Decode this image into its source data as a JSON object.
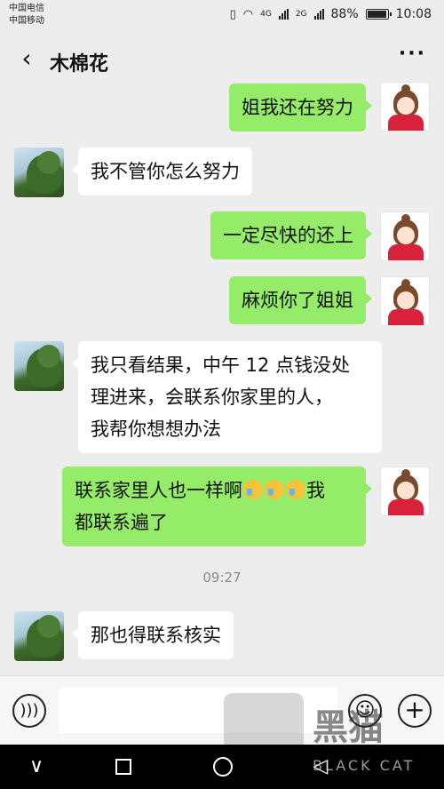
{
  "status_bar": {
    "carrier1": "中国电信",
    "carrier2": "中国移动",
    "battery": "88%",
    "time": "10:08",
    "network": "4G",
    "network2": "2G"
  },
  "header": {
    "title": "木棉花",
    "back_icon": "chevron-left-icon",
    "more_icon": "ellipsis-icon"
  },
  "messages": [
    {
      "side": "right",
      "text": "姐我还在努力"
    },
    {
      "side": "left",
      "text": "我不管你怎么努力"
    },
    {
      "side": "right",
      "text": "一定尽快的还上"
    },
    {
      "side": "right",
      "text": "麻烦你了姐姐"
    },
    {
      "side": "left",
      "line1": "我只看结果，中午 12 点钱没处",
      "line2": "理进来，会联系你家里的人，",
      "line3": "我帮你想想办法"
    },
    {
      "side": "right",
      "line1": "联系家里人也一样啊",
      "line1_tail": "我",
      "line2": "都联系遍了",
      "emoji": "crying-laughing-emoji"
    },
    {
      "side": "left",
      "text": "那也得联系核实"
    }
  ],
  "timestamp": "09:27",
  "input_bar": {
    "voice_icon": "voice-icon",
    "emoji_icon": "smiley-icon",
    "plus_icon": "plus-icon"
  },
  "watermark": {
    "text": "黑猫",
    "sub": "BLACK CAT"
  },
  "colors": {
    "background": "#ededed",
    "bubble_green": "#95ec69",
    "bubble_white": "#ffffff"
  }
}
